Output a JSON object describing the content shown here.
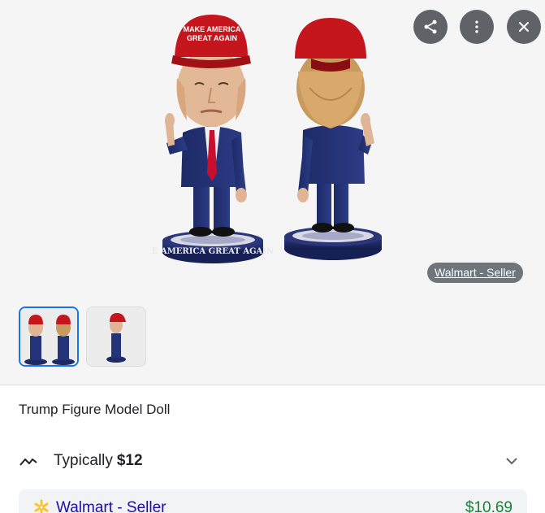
{
  "viewer": {
    "image_alt": "MAGA bobblehead figure, front and back",
    "source_chip_label": "Walmart - Seller",
    "product_image_text": {
      "hat_line_1": "MAKE AMERICA",
      "hat_line_2": "GREAT AGAIN",
      "base_text": "E AMERICA GREAT AGAIN"
    }
  },
  "actions": {
    "share": "share-icon",
    "more": "more-vert-icon",
    "close": "close-icon"
  },
  "thumbnails": [
    {
      "selected": true
    },
    {
      "selected": false
    }
  ],
  "product": {
    "title": "Trump Figure Model Doll"
  },
  "price_summary": {
    "label": "Typically",
    "value": "$12"
  },
  "offers": [
    {
      "seller": "Walmart - Seller",
      "price": "$10.69"
    }
  ],
  "colors": {
    "link": "#1a0dab",
    "price_green": "#188038",
    "selected_outline": "#1a73e8",
    "walmart_spark": "#ffc220"
  }
}
